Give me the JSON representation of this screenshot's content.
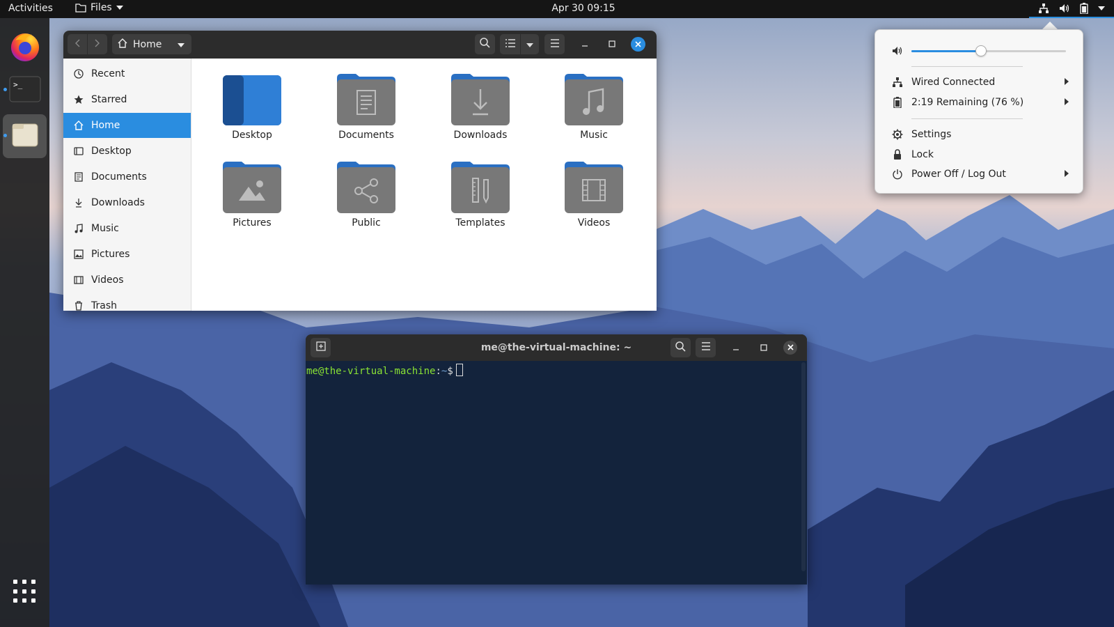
{
  "topbar": {
    "activities": "Activities",
    "app_name": "Files",
    "clock": "Apr 30  09:15"
  },
  "files": {
    "path_label": "Home",
    "sidebar": [
      {
        "label": "Recent",
        "icon": "clock-icon"
      },
      {
        "label": "Starred",
        "icon": "star-icon"
      },
      {
        "label": "Home",
        "icon": "home-icon",
        "selected": true
      },
      {
        "label": "Desktop",
        "icon": "desktop-icon"
      },
      {
        "label": "Documents",
        "icon": "document-icon"
      },
      {
        "label": "Downloads",
        "icon": "download-icon"
      },
      {
        "label": "Music",
        "icon": "music-icon"
      },
      {
        "label": "Pictures",
        "icon": "picture-icon"
      },
      {
        "label": "Videos",
        "icon": "video-icon"
      },
      {
        "label": "Trash",
        "icon": "trash-icon"
      }
    ],
    "folders": [
      {
        "label": "Desktop",
        "icon": "desktop-folder-icon"
      },
      {
        "label": "Documents",
        "icon": "documents-folder-icon"
      },
      {
        "label": "Downloads",
        "icon": "downloads-folder-icon"
      },
      {
        "label": "Music",
        "icon": "music-folder-icon"
      },
      {
        "label": "Pictures",
        "icon": "pictures-folder-icon"
      },
      {
        "label": "Public",
        "icon": "public-folder-icon"
      },
      {
        "label": "Templates",
        "icon": "templates-folder-icon"
      },
      {
        "label": "Videos",
        "icon": "videos-folder-icon"
      }
    ]
  },
  "terminal": {
    "title": "me@the-virtual-machine: ~",
    "prompt_user": "me@the-virtual-machine",
    "prompt_sep": ":",
    "prompt_path": "~",
    "prompt_symbol": "$"
  },
  "system_menu": {
    "volume_fraction": 0.45,
    "wired": "Wired Connected",
    "battery": "2:19 Remaining (76 %)",
    "settings": "Settings",
    "lock": "Lock",
    "power": "Power Off / Log Out"
  },
  "colors": {
    "accent": "#2a8de0",
    "topbar": "#151515",
    "terminal_bg": "#13233c",
    "folder_blue": "#2a6fc2",
    "folder_gray": "#777777"
  }
}
